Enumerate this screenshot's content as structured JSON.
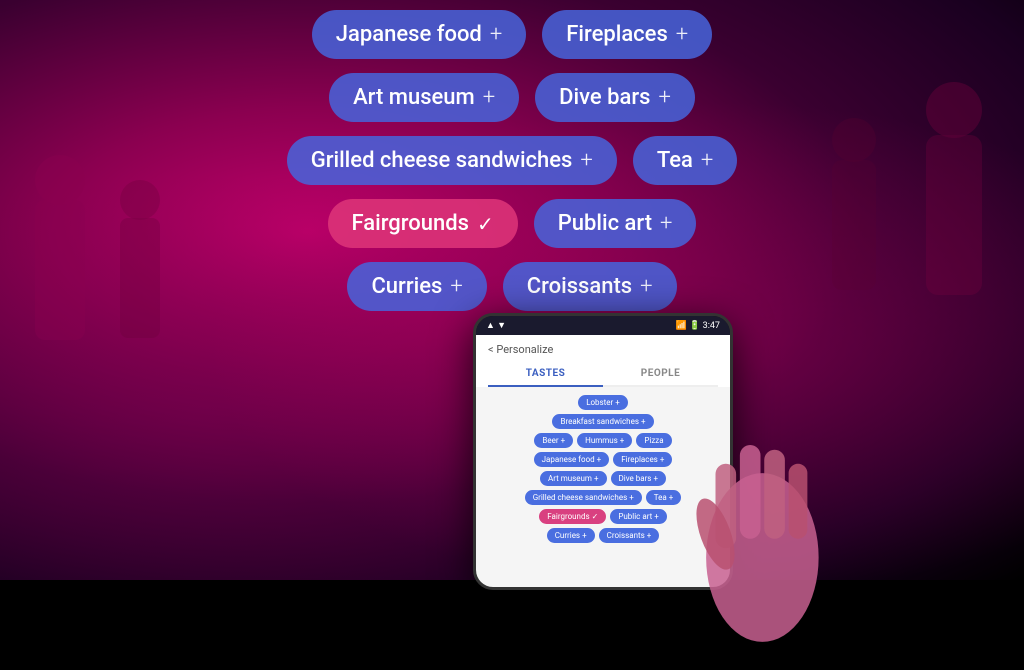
{
  "background": {
    "description": "Dark stage with pink/purple lighting and crowd silhouettes"
  },
  "chips": {
    "rows": [
      [
        {
          "label": "Japanese food",
          "type": "blue",
          "icon": "+"
        },
        {
          "label": "Fireplaces",
          "type": "blue",
          "icon": "+"
        }
      ],
      [
        {
          "label": "Art museum",
          "type": "blue",
          "icon": "+"
        },
        {
          "label": "Dive bars",
          "type": "blue",
          "icon": "+"
        }
      ],
      [
        {
          "label": "Grilled cheese sandwiches",
          "type": "blue",
          "icon": "+"
        },
        {
          "label": "Tea",
          "type": "blue",
          "icon": "+"
        }
      ],
      [
        {
          "label": "Fairgrounds",
          "type": "selected",
          "icon": "✓"
        },
        {
          "label": "Public art",
          "type": "blue",
          "icon": "+"
        }
      ],
      [
        {
          "label": "Curries",
          "type": "blue",
          "icon": "+"
        },
        {
          "label": "Croissants",
          "type": "blue",
          "icon": "+"
        }
      ]
    ]
  },
  "phone": {
    "status_bar": {
      "left": "",
      "right": "3:47"
    },
    "title": "Personalize",
    "back_label": "< Personalize",
    "tabs": [
      "TASTES",
      "PEOPLE"
    ],
    "active_tab": "TASTES",
    "chip_rows": [
      [
        {
          "label": "Lobster",
          "icon": "+",
          "type": "blue"
        }
      ],
      [
        {
          "label": "Breakfast sandwiches",
          "icon": "+",
          "type": "blue"
        }
      ],
      [
        {
          "label": "Beer",
          "icon": "+",
          "type": "blue"
        },
        {
          "label": "Hummus",
          "icon": "+",
          "type": "blue"
        },
        {
          "label": "Pizza",
          "type": "blue",
          "icon": ""
        }
      ],
      [
        {
          "label": "Japanese food",
          "icon": "+",
          "type": "blue"
        },
        {
          "label": "Fireplaces",
          "icon": "+",
          "type": "blue"
        }
      ],
      [
        {
          "label": "Art museum",
          "icon": "+",
          "type": "blue"
        },
        {
          "label": "Dive bars",
          "icon": "+",
          "type": "blue"
        }
      ],
      [
        {
          "label": "Grilled cheese sandwiches",
          "icon": "+",
          "type": "blue"
        },
        {
          "label": "Tea",
          "icon": "+",
          "type": "blue"
        }
      ],
      [
        {
          "label": "Fairgrounds",
          "icon": "✓",
          "type": "selected"
        },
        {
          "label": "Public art",
          "icon": "+",
          "type": "blue"
        }
      ],
      [
        {
          "label": "Curries",
          "icon": "+",
          "type": "blue"
        },
        {
          "label": "Croissants",
          "icon": "+",
          "type": "blue"
        }
      ]
    ]
  }
}
